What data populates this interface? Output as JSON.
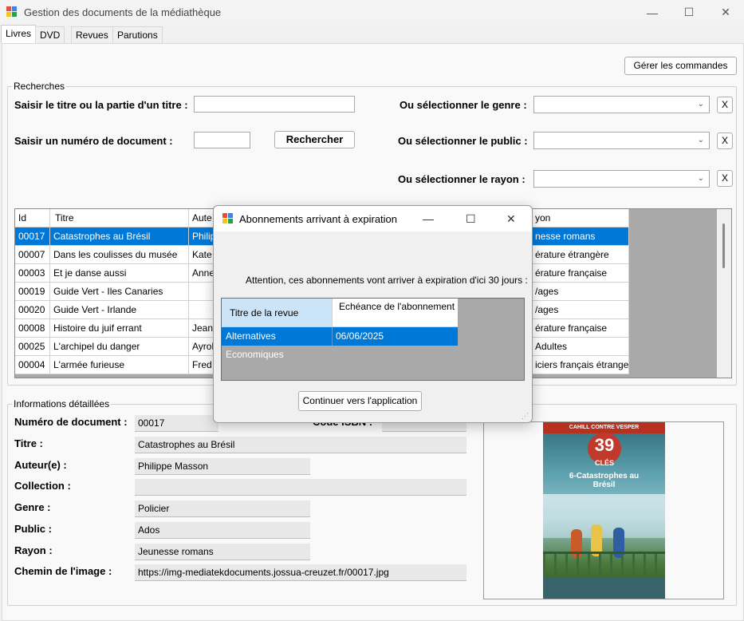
{
  "window": {
    "title": "Gestion des documents de la médiathèque",
    "minimize_glyph": "—",
    "maximize_glyph": "☐",
    "close_glyph": "✕"
  },
  "tabs": [
    {
      "label": "Livres",
      "active": true
    },
    {
      "label": "DVD"
    },
    {
      "label": "Revues"
    },
    {
      "label": "Parutions des revues"
    }
  ],
  "toolbar": {
    "manage_orders": "Gérer les commandes"
  },
  "search": {
    "group_label": "Recherches",
    "title_label": "Saisir le titre ou la partie d'un titre :",
    "title_value": "",
    "number_label": "Saisir un numéro de document :",
    "number_value": "",
    "search_button": "Rechercher",
    "genre_label": "Ou sélectionner le genre :",
    "public_label": "Ou sélectionner le public :",
    "rayon_label": "Ou sélectionner le rayon :",
    "clear_label": "X"
  },
  "books_table": {
    "columns": [
      "Id",
      "Titre",
      "Auteur(e)",
      "Rayon"
    ],
    "visible_headers": [
      "Id",
      "Titre",
      "Aute",
      "yon"
    ],
    "rows": [
      {
        "id": "00017",
        "titre": "Catastrophes au Brésil",
        "auteur": "Philip",
        "rayon": "nesse romans",
        "selected": true
      },
      {
        "id": "00007",
        "titre": "Dans les coulisses du musée",
        "auteur": "Kate",
        "rayon": "érature étrangère"
      },
      {
        "id": "00003",
        "titre": "Et je danse aussi",
        "auteur": "Anne",
        "rayon": "érature française"
      },
      {
        "id": "00019",
        "titre": "Guide Vert - Iles Canaries",
        "auteur": "",
        "rayon": "/ages"
      },
      {
        "id": "00020",
        "titre": "Guide Vert - Irlande",
        "auteur": "",
        "rayon": "/ages"
      },
      {
        "id": "00008",
        "titre": "Histoire du juif errant",
        "auteur": "Jean",
        "rayon": "érature française"
      },
      {
        "id": "00025",
        "titre": "L'archipel du danger",
        "auteur": "Ayroll",
        "rayon": "Adultes"
      },
      {
        "id": "00004",
        "titre": "L'armée furieuse",
        "auteur": "Fred V",
        "rayon": "iciers français étrangers"
      }
    ]
  },
  "details": {
    "group_label": "Informations détaillées",
    "numero_label": "Numéro de document :",
    "numero_value": "00017",
    "isbn_label": "Code ISBN :",
    "isbn_value": "",
    "titre_label": "Titre :",
    "titre_value": "Catastrophes au Brésil",
    "auteur_label": "Auteur(e) :",
    "auteur_value": "Philippe Masson",
    "collection_label": "Collection :",
    "collection_value": "",
    "genre_label": "Genre :",
    "genre_value": "Policier",
    "public_label": "Public :",
    "public_value": "Ados",
    "rayon_label": "Rayon :",
    "rayon_value": "Jeunesse romans",
    "image_label": "Chemin de l'image :",
    "image_value": "https://img-mediatekdocuments.jossua-creuzet.fr/00017.jpg"
  },
  "cover": {
    "series": "39",
    "series_word": "CLÉS",
    "subtitle": "6-Catastrophes au Brésil",
    "brand": "CAHILL CONTRE VESPER"
  },
  "dialog": {
    "title": "Abonnements arrivant à expiration",
    "message": "Attention, ces abonnements vont arriver à expiration d'ici 30 jours :",
    "columns": [
      "Titre de la revue",
      "Echéance de l'abonnement"
    ],
    "rows": [
      {
        "titre": "Alternatives Economiques",
        "echeance": "06/06/2025"
      }
    ],
    "continue_button": "Continuer vers l'application"
  },
  "colors": {
    "selection": "#0078d7",
    "header_selected": "#cce4f7",
    "grid_bg": "#a9a9a9"
  }
}
